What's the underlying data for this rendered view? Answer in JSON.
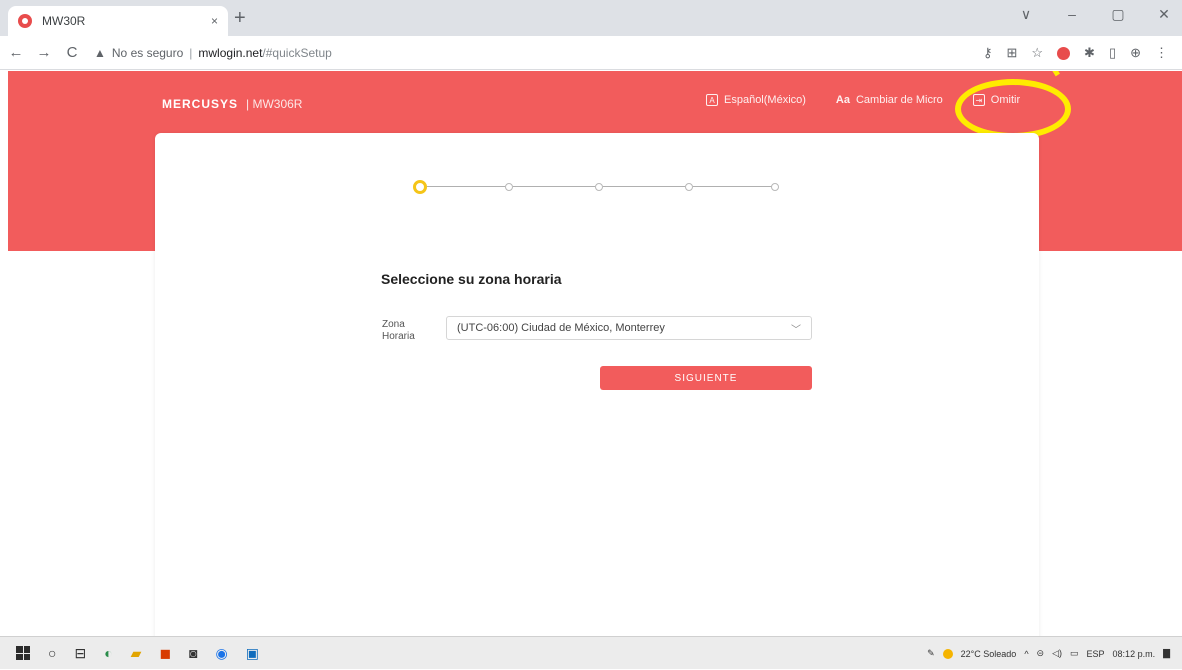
{
  "browser": {
    "tab_title": "MW30R",
    "tab_close": "×",
    "new_tab": "+",
    "window_controls": [
      "∨",
      "–",
      "▢",
      "✕"
    ],
    "not_secure": "No es seguro",
    "url_host": "mwlogin.net",
    "url_path": "/#quickSetup",
    "toolbar_icons": [
      "key-icon",
      "translate-icon",
      "star-icon",
      "mercusys-extension-icon",
      "puzzle-icon",
      "sidepanel-icon",
      "profile-icon",
      "menu-icon"
    ]
  },
  "header": {
    "brand": "MERCUSYS",
    "model": "| MW306R",
    "language": "Español(México)",
    "change_password": "Cambiar de Micro",
    "exit": "Omitir"
  },
  "wizard": {
    "total_steps": 5,
    "current_step": 1,
    "title": "Seleccione su zona horaria",
    "timezone_label": "Zona Horaria",
    "timezone_value": "(UTC-06:00) Ciudad de México, Monterrey",
    "next_button": "SIGUIENTE"
  },
  "taskbar": {
    "weather": "22°C Soleado",
    "language": "ESP",
    "time": "08:12 p.m."
  },
  "colors": {
    "brand_red": "#f25c5c",
    "highlight": "#ffec00",
    "step_active": "#f5c518"
  }
}
